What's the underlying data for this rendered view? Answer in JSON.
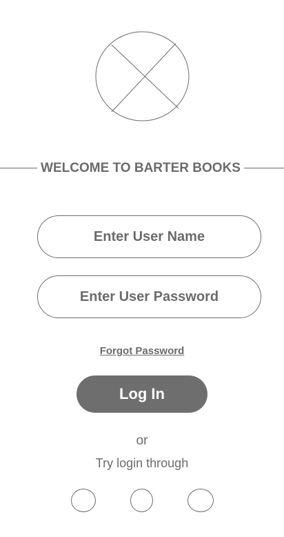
{
  "logo": {
    "icon": "image-placeholder-icon"
  },
  "welcome_title": "WELCOME TO BARTER BOOKS",
  "username_field": {
    "placeholder": "Enter User Name",
    "value": ""
  },
  "password_field": {
    "placeholder": "Enter User Password",
    "value": ""
  },
  "forgot_password_label": "Forgot Password",
  "login_button_label": "Log In",
  "or_label": "or",
  "try_login_label": "Try login through",
  "social_buttons": [
    {
      "icon": "social-login-icon"
    },
    {
      "icon": "social-login-icon"
    },
    {
      "icon": "social-login-icon"
    }
  ],
  "colors": {
    "text": "#6b6b6b",
    "button_bg": "#6e6e6e",
    "button_text": "#ffffff",
    "background": "#ffffff"
  }
}
